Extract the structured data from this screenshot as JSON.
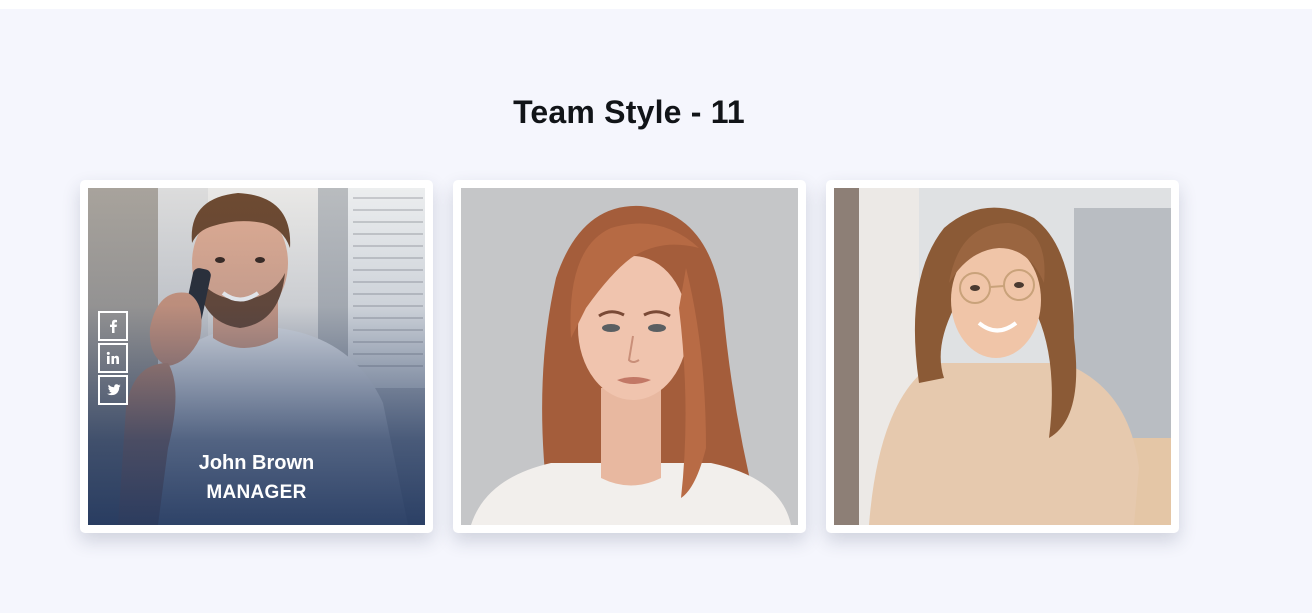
{
  "section": {
    "title": "Team Style - 11"
  },
  "team": [
    {
      "name": "John Brown",
      "role": "MANAGER",
      "photo": "man-on-phone-photo",
      "social": [
        "facebook-icon",
        "linkedin-icon",
        "twitter-icon"
      ]
    },
    {
      "photo": "woman-red-hair-photo"
    },
    {
      "photo": "woman-glasses-photo"
    }
  ],
  "colors": {
    "background": "#f5f6fd",
    "card": "#ffffff",
    "title": "#111418",
    "overlay": "#1e345c"
  }
}
